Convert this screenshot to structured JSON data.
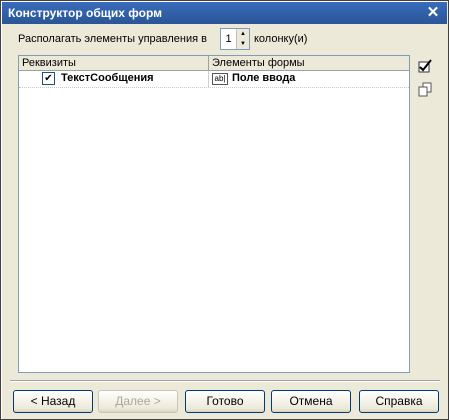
{
  "window": {
    "title": "Конструктор общих форм"
  },
  "arrange": {
    "label": "Располагать элементы управления в",
    "value": "1",
    "suffix": "колонку(и)"
  },
  "grid": {
    "columns": [
      "Реквизиты",
      "Элементы формы"
    ],
    "rows": [
      {
        "checked": true,
        "check_glyph": "✔",
        "field": "ТекстСообщения",
        "element_icon": "ab|",
        "element": "Поле ввода"
      }
    ]
  },
  "buttons": {
    "back": "< Назад",
    "next": "Далее >",
    "done": "Готово",
    "cancel": "Отмена",
    "help": "Справка"
  },
  "icons": {
    "close": "✕",
    "spin_up": "▲",
    "spin_down": "▼"
  },
  "colors": {
    "titlebar": "#2f5fa8",
    "face": "#ece9d8"
  }
}
